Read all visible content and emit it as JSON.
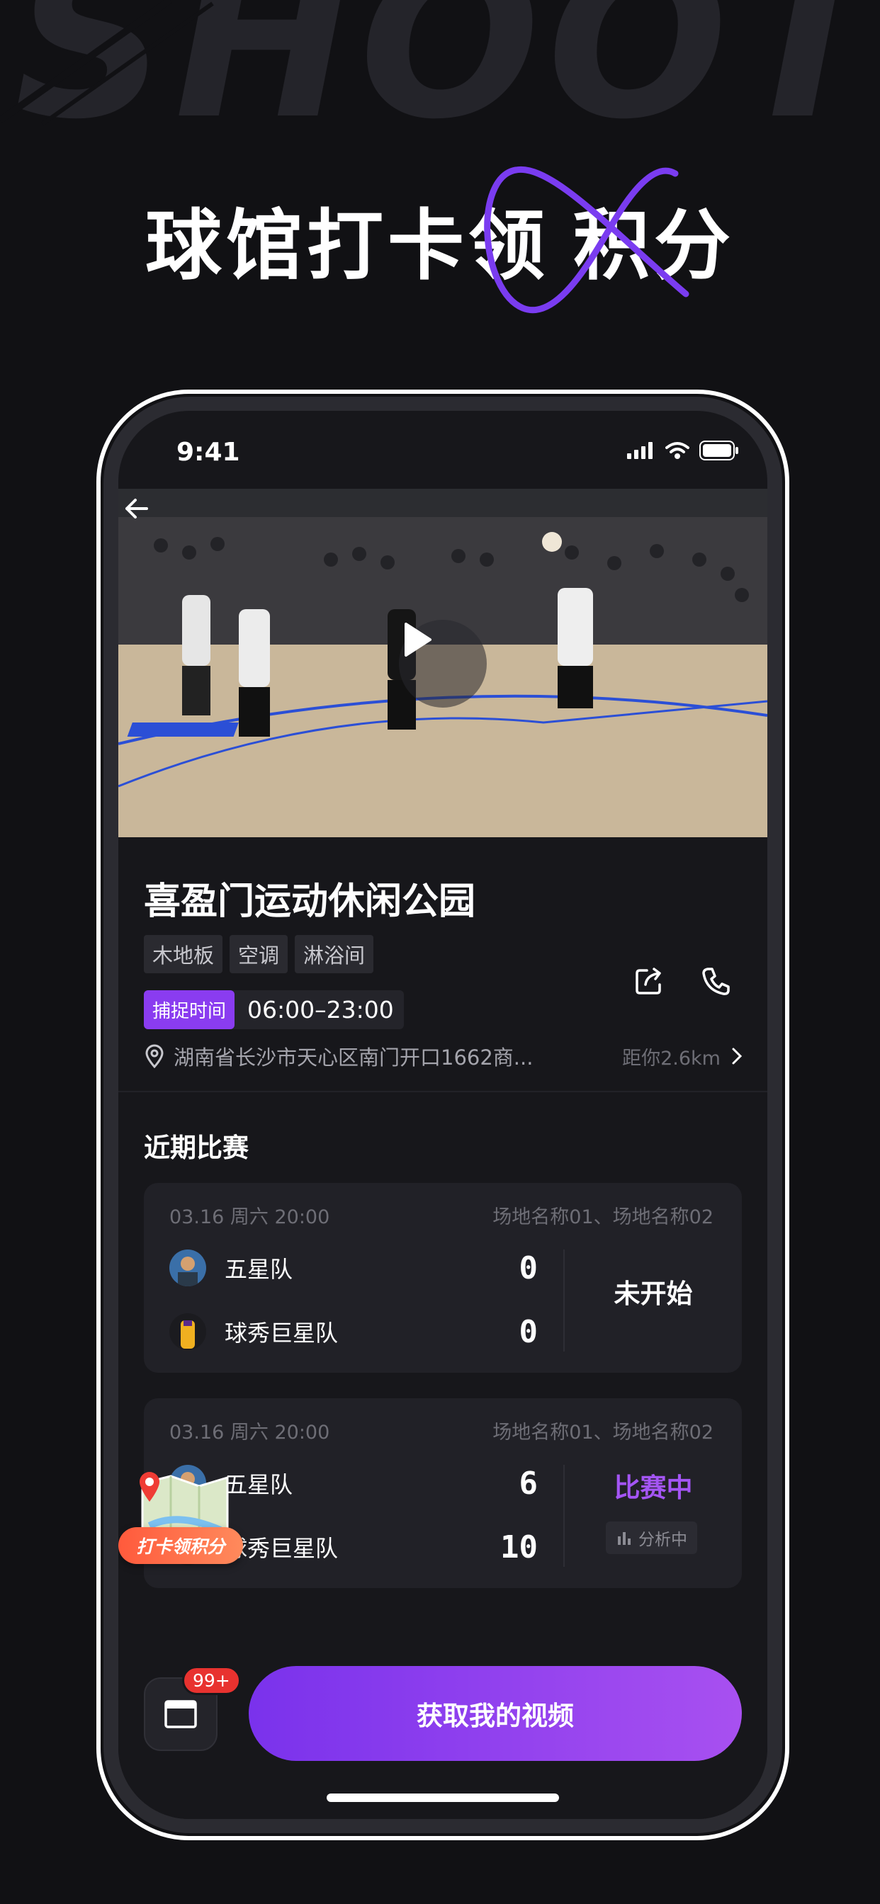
{
  "brand": "SHOOTZ",
  "headline": {
    "part1": "球馆打卡领",
    "part2": "积分"
  },
  "status_bar": {
    "time": "9:41"
  },
  "venue": {
    "name": "喜盈门运动休闲公园",
    "tags": [
      "木地板",
      "空调",
      "淋浴间"
    ],
    "hours_label": "捕捉时间",
    "hours_value": "06:00–23:00",
    "address": "湖南省长沙市天心区南门开口1662商...",
    "distance": "距你2.6km"
  },
  "recent_matches": {
    "title": "近期比赛",
    "matches": [
      {
        "date": "03.16 周六 20:00",
        "venue": "场地名称01、场地名称02",
        "team_a": "五星队",
        "score_a": "0",
        "team_b": "球秀巨星队",
        "score_b": "0",
        "status": "未开始"
      },
      {
        "date": "03.16 周六 20:00",
        "venue": "场地名称01、场地名称02",
        "team_a": "五星队",
        "score_a": "6",
        "team_b": "球秀巨星队",
        "score_b": "10",
        "status": "比赛中",
        "sub_status": "分析中"
      }
    ]
  },
  "floating_badge": {
    "label": "打卡领积分"
  },
  "bottom": {
    "badge_count": "99+",
    "cta_label": "获取我的视频"
  },
  "colors": {
    "accent": "#8a3cf0",
    "live_status": "#a455f5",
    "badge": "#e8322f",
    "background": "#111114"
  },
  "icons": [
    "back-arrow-icon",
    "play-icon",
    "share-icon",
    "phone-icon",
    "location-pin-icon",
    "chevron-right-icon",
    "folder-icon",
    "bar-chart-icon",
    "map-pin-icon",
    "signal-icon",
    "wifi-icon",
    "battery-icon"
  ]
}
